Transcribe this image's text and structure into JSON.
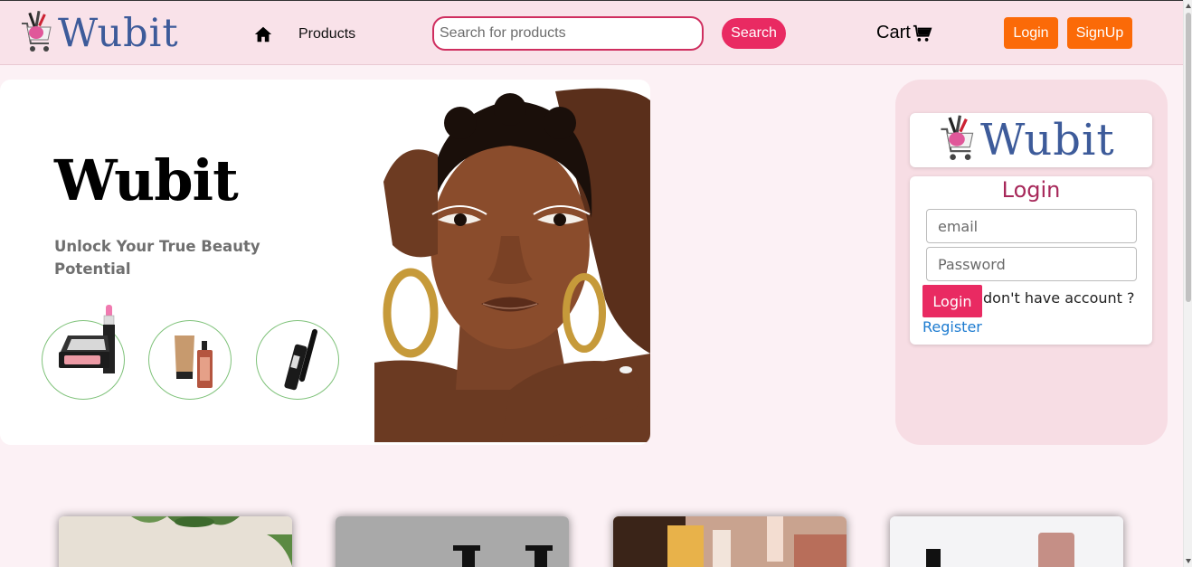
{
  "header": {
    "logo_text": "Wubit",
    "nav_products": "Products",
    "search_placeholder": "Search for products",
    "search_button": "Search",
    "cart_label": "Cart",
    "login_button": "Login",
    "signup_button": "SignUp"
  },
  "hero": {
    "title": "Wubit",
    "subtitle": "Unlock Your True Beauty Potential",
    "product_icons": [
      "compact-lipstick-icon",
      "skincare-bottles-icon",
      "mascara-icon"
    ]
  },
  "login_panel": {
    "logo_text": "Wubit",
    "heading": "Login",
    "email_placeholder": "email",
    "password_placeholder": "Password",
    "login_button": "Login",
    "no_account_text": "don't have account ?",
    "register_link": "Register"
  },
  "colors": {
    "header_bg": "#f9e2e9",
    "brand_blue": "#3d5b9a",
    "accent_pink": "#e92a62",
    "accent_orange": "#fb6a08",
    "panel_bg": "#f7dde4"
  }
}
